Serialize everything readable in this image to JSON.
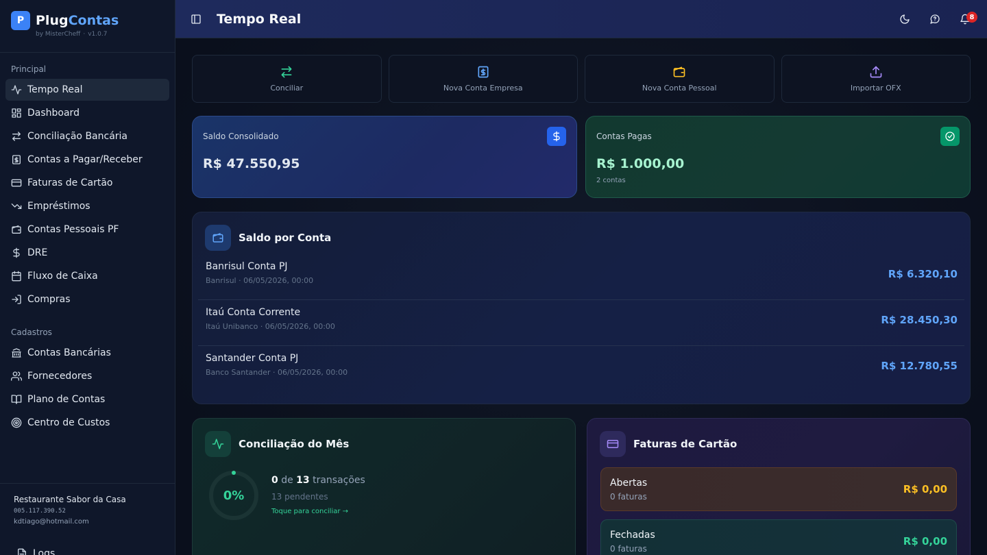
{
  "brand": {
    "prefix": "Plug",
    "suffix": "Contas",
    "logo_letter": "P",
    "by": "by MisterCheff",
    "version": "v1.0.7"
  },
  "sidebar": {
    "section_principal": "Principal",
    "principal": [
      {
        "label": "Tempo Real",
        "icon": "activity-icon",
        "active": true
      },
      {
        "label": "Dashboard",
        "icon": "dashboard-icon"
      },
      {
        "label": "Conciliação Bancária",
        "icon": "arrows-icon"
      },
      {
        "label": "Contas a Pagar/Receber",
        "icon": "receipt-icon"
      },
      {
        "label": "Faturas de Cartão",
        "icon": "credit-card-icon"
      },
      {
        "label": "Empréstimos",
        "icon": "trending-down-icon"
      },
      {
        "label": "Contas Pessoais PF",
        "icon": "wallet-icon"
      },
      {
        "label": "DRE",
        "icon": "dollar-icon"
      },
      {
        "label": "Fluxo de Caixa",
        "icon": "calendar-icon"
      },
      {
        "label": "Compras",
        "icon": "login-icon"
      }
    ],
    "section_cadastros": "Cadastros",
    "cadastros": [
      {
        "label": "Contas Bancárias",
        "icon": "bank-icon"
      },
      {
        "label": "Fornecedores",
        "icon": "users-icon"
      },
      {
        "label": "Plano de Contas",
        "icon": "book-icon"
      },
      {
        "label": "Centro de Custos",
        "icon": "target-icon"
      }
    ],
    "company": {
      "name": "Restaurante Sabor da Casa",
      "cnpj": "005.117.390.52",
      "email": "kdtiago@hotmail.com"
    },
    "logs": "Logs"
  },
  "header": {
    "title": "Tempo Real",
    "notification_count": "8"
  },
  "actions": [
    {
      "label": "Conciliar",
      "icon": "arrows-icon",
      "color": "#34d399"
    },
    {
      "label": "Nova Conta Empresa",
      "icon": "receipt-icon",
      "color": "#60a5fa"
    },
    {
      "label": "Nova Conta Pessoal",
      "icon": "wallet-icon",
      "color": "#fbbf24"
    },
    {
      "label": "Importar OFX",
      "icon": "upload-icon",
      "color": "#a78bfa"
    }
  ],
  "saldo": {
    "label": "Saldo Consolidado",
    "value": "R$ 47.550,95"
  },
  "pagas": {
    "label": "Contas Pagas",
    "value": "R$ 1.000,00",
    "sub": "2 contas"
  },
  "saldo_por_conta": {
    "title": "Saldo por Conta",
    "accounts": [
      {
        "name": "Banrisul Conta PJ",
        "meta": "Banrisul · 06/05/2026, 00:00",
        "value": "R$ 6.320,10"
      },
      {
        "name": "Itaú Conta Corrente",
        "meta": "Itaú Unibanco · 06/05/2026, 00:00",
        "value": "R$ 28.450,30"
      },
      {
        "name": "Santander Conta PJ",
        "meta": "Banco Santander · 06/05/2026, 00:00",
        "value": "R$ 12.780,55"
      }
    ]
  },
  "conciliacao": {
    "title": "Conciliação do Mês",
    "percent": "0%",
    "done": "0",
    "of": "de",
    "total": "13",
    "unit": "transações",
    "pending": "13 pendentes",
    "link": "Toque para conciliar →",
    "progress": 0
  },
  "faturas": {
    "title": "Faturas de Cartão",
    "open": {
      "label": "Abertas",
      "count": "0 faturas",
      "value": "R$ 0,00",
      "color": "#fbbf24"
    },
    "closed": {
      "label": "Fechadas",
      "count": "0 faturas",
      "value": "R$ 0,00",
      "color": "#34d399"
    }
  }
}
